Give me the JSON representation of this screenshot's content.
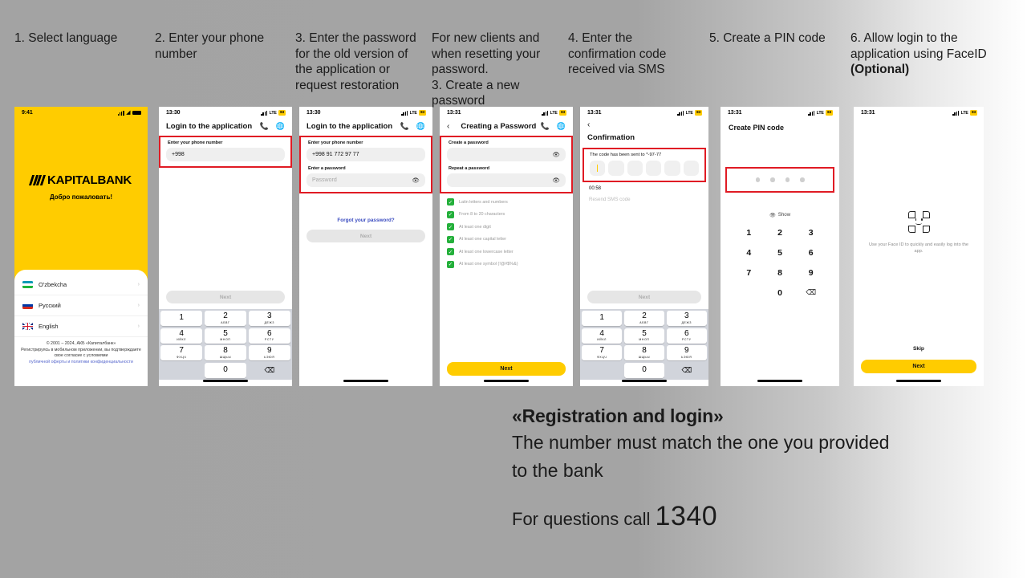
{
  "captions": [
    {
      "text": "1. Select language"
    },
    {
      "text": "2. Enter your phone number"
    },
    {
      "text": "3. Enter the password for the old version of the application or request restoration"
    },
    {
      "text": "For new clients and when resetting your password.\n3. Create a new password"
    },
    {
      "text": "4. Enter the confirmation code received via SMS"
    },
    {
      "text": "5. Create a PIN code"
    },
    {
      "text_pre": "6. Allow login to the application using FaceID ",
      "text_bold": "(Optional)"
    }
  ],
  "phone1": {
    "status_time": "9:41",
    "brand": "KAPITALBANK",
    "welcome": "Добро пожаловать!",
    "languages": [
      {
        "name": "O'zbekcha",
        "chevron": "›"
      },
      {
        "name": "Русский",
        "chevron": "›"
      },
      {
        "name": "English",
        "chevron": "›"
      }
    ],
    "legal_line1": "© 2001 – 2024, АКБ «Капиталбанк»",
    "legal_line2": "Регистрируясь в мобильном приложении, вы подтверждаете свое согласие с условиями",
    "legal_link": "публичной оферты и политики конфиденциальности"
  },
  "phone2": {
    "status_time": "13:30",
    "status_lte": "LTE",
    "status_battery": "83",
    "title": "Login to the application",
    "phone_label": "Enter your phone number",
    "phone_value": "+998",
    "next_label": "Next",
    "keypad": [
      {
        "num": "1",
        "sub": ""
      },
      {
        "num": "2",
        "sub": "АБВГ"
      },
      {
        "num": "3",
        "sub": "ДЕЖЗ"
      },
      {
        "num": "4",
        "sub": "ИЙКЛ"
      },
      {
        "num": "5",
        "sub": "МНОП"
      },
      {
        "num": "6",
        "sub": "РСТУ"
      },
      {
        "num": "7",
        "sub": "ФХЦЧ"
      },
      {
        "num": "8",
        "sub": "ШЩЬЫ"
      },
      {
        "num": "9",
        "sub": "ЬЭЮЯ"
      },
      {
        "num": "0",
        "sub": ""
      }
    ]
  },
  "phone3": {
    "status_time": "13:30",
    "status_lte": "LTE",
    "status_battery": "83",
    "title": "Login to the application",
    "phone_label": "Enter your phone number",
    "phone_value": "+998 91 772 97 77",
    "password_label": "Enter a password",
    "password_placeholder": "Password",
    "forgot_link": "Forgot your password?",
    "next_label": "Next"
  },
  "phone4": {
    "status_time": "13:31",
    "status_lte": "LTE",
    "status_battery": "83",
    "title": "Creating a Password",
    "create_label": "Create a password",
    "repeat_label": "Repeat a password",
    "rules": [
      "Latin letters and numbers",
      "From 8 to 20 characters",
      "At least one digit",
      "At least one capital letter",
      "At least one lowercase letter",
      "At least one symbol (!@#$%&)"
    ],
    "next_label": "Next"
  },
  "phone5": {
    "status_time": "13:31",
    "status_lte": "LTE",
    "status_battery": "83",
    "title": "Confirmation",
    "sent_note": "The code has been sent to *-97-77",
    "timer": "00:58",
    "resend_label": "Resend SMS code",
    "next_label": "Next",
    "cells": 6
  },
  "phone6": {
    "status_time": "13:31",
    "status_lte": "LTE",
    "status_battery": "83",
    "title": "Create PIN code",
    "show_label": "Show",
    "dots": 4,
    "keypad_rows": [
      [
        "1",
        "2",
        "3"
      ],
      [
        "4",
        "5",
        "6"
      ],
      [
        "7",
        "8",
        "9"
      ],
      [
        "",
        "0",
        "⌫"
      ]
    ]
  },
  "phone7": {
    "status_time": "13:31",
    "status_lte": "LTE",
    "status_battery": "83",
    "face_text": "Use your Face ID to quickly and easily log into the app.",
    "skip_label": "Skip",
    "next_label": "Next"
  },
  "footer": {
    "title": "«Registration and login»",
    "body_line1": "The number must match the one you provided",
    "body_line2": "to the bank",
    "call_prefix": "For questions call ",
    "call_number": "1340"
  },
  "colors": {
    "brand_yellow": "#FFCC00",
    "highlight_red": "#e01b24",
    "check_green": "#24b03b",
    "link_blue": "#3b4cc0"
  }
}
